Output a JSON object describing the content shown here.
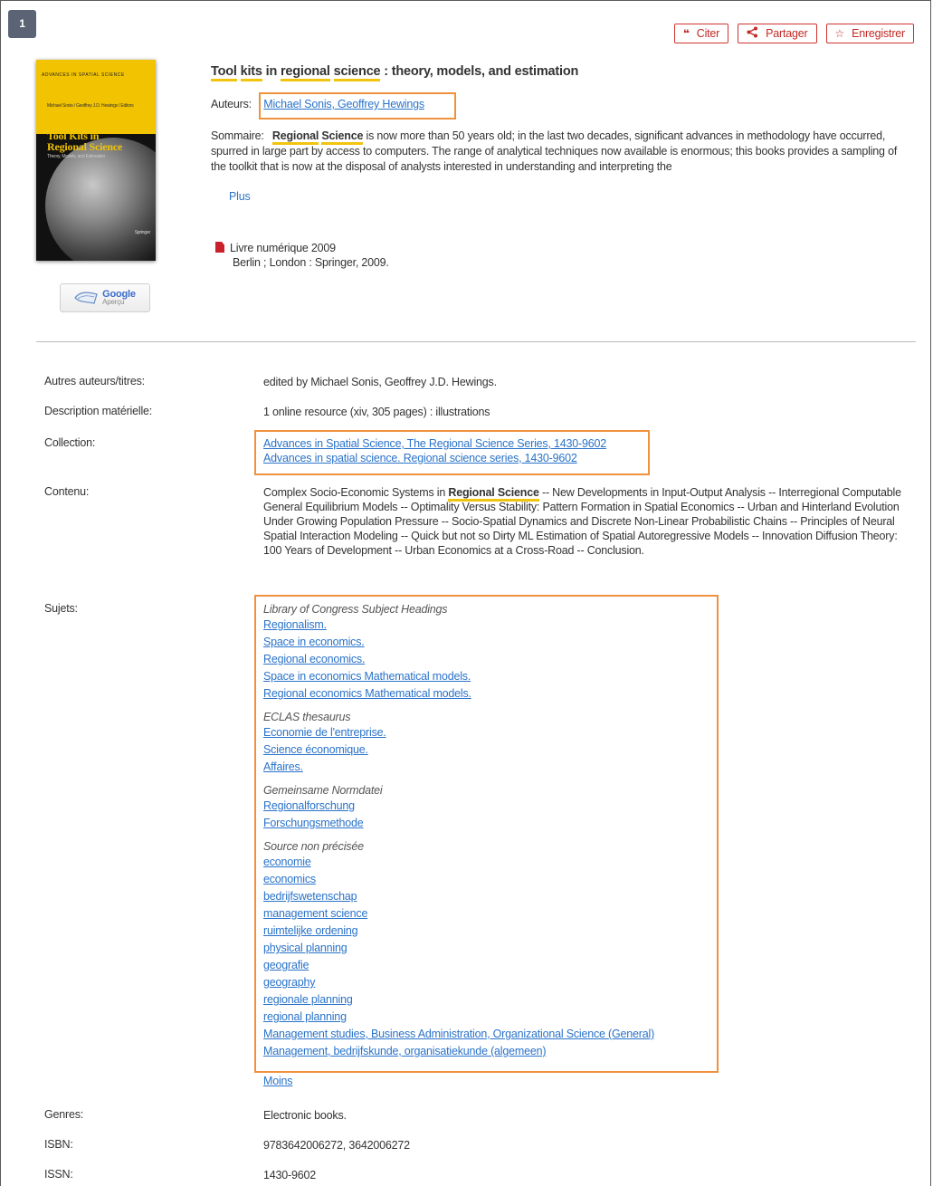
{
  "result_number": "1",
  "actions": {
    "cite": "Citer",
    "share": "Partager",
    "save": "Enregistrer"
  },
  "cover": {
    "series": "ADVANCES IN SPATIAL SCIENCE",
    "authors": "Michael Sonis / Geoffrey J.D. Hewings / Editors",
    "title_line1": "Tool Kits in",
    "title_line2": "Regional Science",
    "subtitle": "Theory, Models, and Estimation",
    "publisher": "Springer"
  },
  "google_preview": {
    "brand": "Google",
    "label": "Aperçu"
  },
  "record": {
    "title_part1": "Tool",
    "title_part2": "kits",
    "title_part3": "in",
    "title_part4": "regional",
    "title_part5": "science",
    "title_rest": ": theory, models, and estimation",
    "authors_label": "Auteurs:",
    "authors": "Michael Sonis, Geoffrey Hewings",
    "summary_label": "Sommaire:",
    "summary_hl1": "Regional",
    "summary_hl2": "Science",
    "summary_text": "is now more than 50 years old; in the last two decades, significant advances in methodology have occurred, spurred in large part by access to computers. The range of analytical techniques now available is enormous; this books provides a sampling of the toolkit that is now at the disposal of analysts interested in understanding and interpreting the",
    "more": "Plus",
    "format": "Livre numérique 2009",
    "publication": "Berlin ; London : Springer, 2009."
  },
  "details": {
    "other_authors_label": "Autres auteurs/titres:",
    "other_authors": "edited by Michael Sonis, Geoffrey J.D. Hewings.",
    "phys_desc_label": "Description matérielle:",
    "phys_desc": "1 online resource (xiv, 305 pages) : illustrations",
    "collection_label": "Collection:",
    "collection_1": "Advances in Spatial Science, The Regional Science Series, 1430-9602",
    "collection_2": "Advances in spatial science. Regional science series, 1430-9602",
    "content_label": "Contenu:",
    "content_pre": "Complex Socio-Economic Systems in",
    "content_hl": "Regional Science",
    "content_rest": "-- New Developments in Input-Output Analysis -- Interregional Computable General Equilibrium Models -- Optimality Versus Stability: Pattern Formation in Spatial Economics -- Urban and Hinterland Evolution Under Growing Population Pressure -- Socio-Spatial Dynamics and Discrete Non-Linear Probabilistic Chains -- Principles of Neural Spatial Interaction Modeling -- Quick but not so Dirty ML Estimation of Spatial Autoregressive Models -- Innovation Diffusion Theory: 100 Years of Development -- Urban Economics at a Cross-Road -- Conclusion.",
    "subjects_label": "Sujets:",
    "subjects": [
      {
        "heading": "Library of Congress Subject Headings",
        "items": [
          "Regionalism.",
          "Space in economics.",
          "Regional economics.",
          "Space in economics Mathematical models.",
          "Regional economics Mathematical models."
        ]
      },
      {
        "heading": "ECLAS thesaurus",
        "items": [
          "Economie de l'entreprise.",
          "Science économique.",
          "Affaires."
        ]
      },
      {
        "heading": "Gemeinsame Normdatei",
        "items": [
          "Regionalforschung",
          "Forschungsmethode"
        ]
      },
      {
        "heading": "Source non précisée",
        "items": [
          "economie",
          "economics",
          "bedrijfswetenschap",
          "management science",
          "ruimtelijke ordening",
          "physical planning",
          "geografie",
          "geography",
          "regionale planning",
          "regional planning",
          "Management studies, Business Administration, Organizational Science (General)",
          "Management, bedrijfskunde, organisatiekunde (algemeen)"
        ]
      }
    ],
    "less": "Moins",
    "genres_label": "Genres:",
    "genres": "Electronic books.",
    "isbn_label": "ISBN:",
    "isbn": "9783642006272, 3642006272",
    "issn_label": "ISSN:",
    "issn": "1430-9602"
  }
}
